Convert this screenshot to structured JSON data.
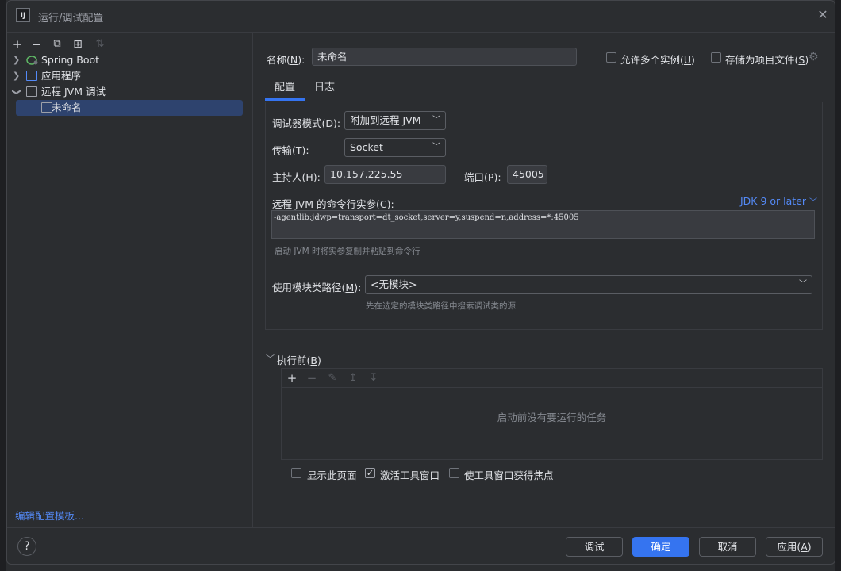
{
  "window": {
    "title": "运行/调试配置",
    "app_icon": "IJ"
  },
  "toolbar": {
    "add": "+",
    "remove": "−",
    "copy": "⧉",
    "new_folder": "⊞",
    "sort": "⇅"
  },
  "tree": {
    "items": [
      {
        "label": "Spring Boot",
        "icon": "spring-boot-icon",
        "expanded": false
      },
      {
        "label": "应用程序",
        "icon": "application-icon",
        "expanded": false
      },
      {
        "label": "远程 JVM 调试",
        "icon": "remote-jvm-debug-icon",
        "expanded": true
      },
      {
        "label": "未命名",
        "icon": "remote-jvm-config-icon",
        "selected": true
      }
    ],
    "edit_templates": "编辑配置模板..."
  },
  "form": {
    "name_label_pre": "名称(",
    "name_label_key": "N",
    "name_label_post": "):",
    "name_value": "未命名",
    "allow_multiple_pre": "允许多个实例(",
    "allow_multiple_key": "U",
    "allow_multiple_post": ")",
    "store_as_file_pre": "存储为项目文件(",
    "store_as_file_key": "S",
    "store_as_file_post": ")"
  },
  "tabs": [
    {
      "label": "配置",
      "active": true
    },
    {
      "label": "日志",
      "active": false
    }
  ],
  "config": {
    "debugger_mode_pre": "调试器模式(",
    "debugger_mode_key": "D",
    "debugger_mode_post": "):",
    "debugger_mode_value": "附加到远程 JVM",
    "transport_pre": "传输(",
    "transport_key": "T",
    "transport_post": "):",
    "transport_value": "Socket",
    "host_pre": "主持人(",
    "host_key": "H",
    "host_post": "):",
    "host_value": "10.157.225.55",
    "port_pre": "端口(",
    "port_key": "P",
    "port_post": "):",
    "port_value": "45005",
    "args_pre": "远程 JVM 的命令行实参(",
    "args_key": "C",
    "args_post": "):",
    "jdk_version": "JDK 9 or later",
    "args_value": "-agentlib:jdwp=transport=dt_socket,server=y,suspend=n,address=*:45005",
    "args_hint": "启动 JVM 时将实参复制并粘贴到命令行",
    "module_pre": "使用模块类路径(",
    "module_key": "M",
    "module_post": "):",
    "module_value": "<无模块>",
    "module_hint": "先在选定的模块类路径中搜索调试类的源"
  },
  "before_launch": {
    "title_pre": "执行前(",
    "title_key": "B",
    "title_post": ")",
    "empty_text": "启动前没有要运行的任务",
    "add": "+",
    "remove": "−",
    "edit": "✎",
    "up": "↥",
    "down": "↧"
  },
  "options": {
    "show_page": "显示此页面",
    "show_page_checked": false,
    "activate_tool_window": "激活工具窗口",
    "activate_tool_window_checked": true,
    "focus_tool_window": "使工具窗口获得焦点",
    "focus_tool_window_checked": false
  },
  "footer": {
    "help": "?",
    "debug": "调试",
    "ok": "确定",
    "cancel": "取消",
    "apply_pre": "应用(",
    "apply_key": "A",
    "apply_post": ")"
  },
  "colors": {
    "accent": "#3574f0",
    "link": "#548af7",
    "selection": "#2e436e",
    "background": "#2b2d30"
  }
}
